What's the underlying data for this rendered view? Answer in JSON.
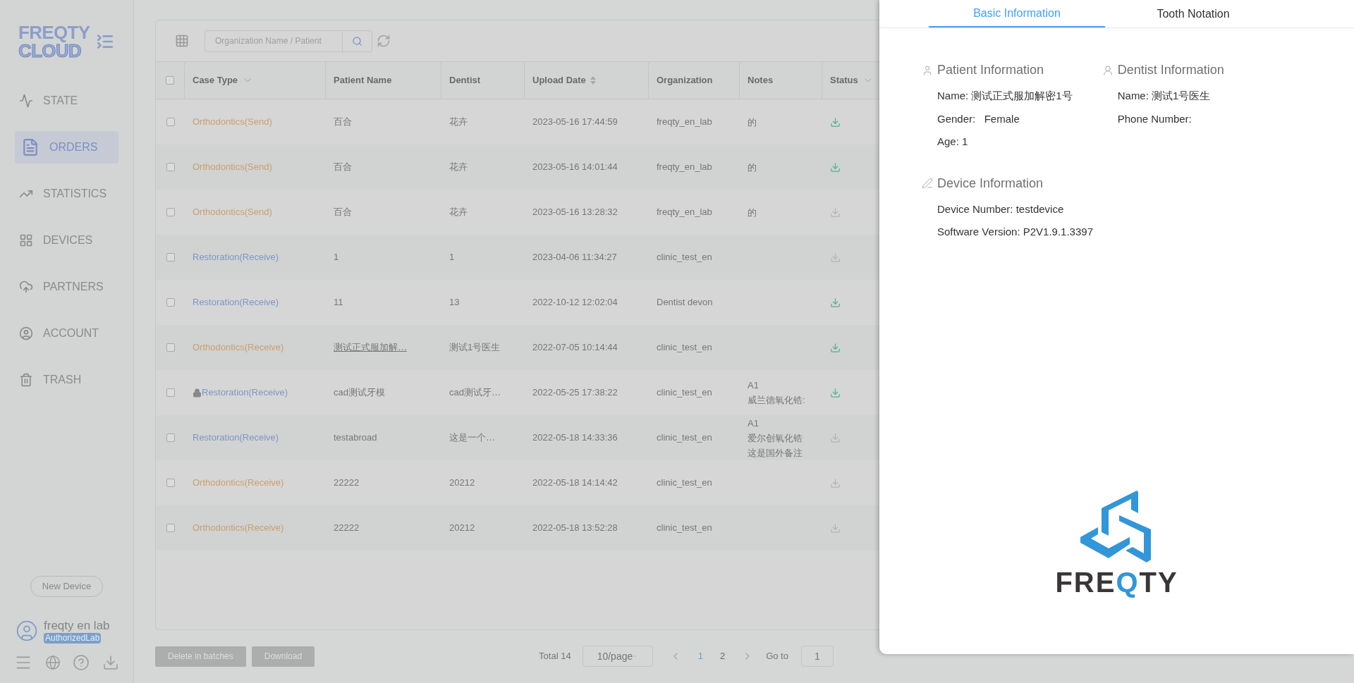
{
  "sidebar": {
    "logo": {
      "line1": "FREQTY",
      "line2": "CLOUD"
    },
    "items": [
      {
        "label": "STATE",
        "selected": false
      },
      {
        "label": "ORDERS",
        "selected": true
      },
      {
        "label": "STATISTICS",
        "selected": false
      },
      {
        "label": "DEVICES",
        "selected": false
      },
      {
        "label": "PARTNERS",
        "selected": false
      },
      {
        "label": "ACCOUNT",
        "selected": false
      },
      {
        "label": "TRASH",
        "selected": false
      }
    ],
    "new_device": "New Device",
    "user": {
      "name": "freqty en lab",
      "role": "AuthorizedLab"
    }
  },
  "toolbar": {
    "search": {
      "placeholder": "Organization Name / Patient"
    }
  },
  "table": {
    "all_checked": false,
    "columns": [
      {
        "label": "Case Type",
        "kind": "filter"
      },
      {
        "label": "Patient Name",
        "kind": "plain"
      },
      {
        "label": "Dentist",
        "kind": "plain"
      },
      {
        "label": "Upload Date",
        "kind": "sort"
      },
      {
        "label": "Organization",
        "kind": "plain"
      },
      {
        "label": "Notes",
        "kind": "plain"
      },
      {
        "label": "Status",
        "kind": "filter"
      }
    ],
    "rows": [
      {
        "checked": false,
        "case_type": "Orthodontics(Send)",
        "kind": "orthodontics",
        "locked": false,
        "patient": "百合",
        "patient_link": false,
        "dentist": "花卉",
        "date": "2023-05-16 17:44:59",
        "organization": "freqty_en_lab",
        "notes": [
          "的"
        ],
        "downloadable": true
      },
      {
        "checked": false,
        "case_type": "Orthodontics(Send)",
        "kind": "orthodontics",
        "locked": false,
        "patient": "百合",
        "patient_link": false,
        "dentist": "花卉",
        "date": "2023-05-16 14:01:44",
        "organization": "freqty_en_lab",
        "notes": [
          "的"
        ],
        "downloadable": true
      },
      {
        "checked": false,
        "case_type": "Orthodontics(Send)",
        "kind": "orthodontics",
        "locked": false,
        "patient": "百合",
        "patient_link": false,
        "dentist": "花卉",
        "date": "2023-05-16 13:28:32",
        "organization": "freqty_en_lab",
        "notes": [
          "的"
        ],
        "downloadable": false
      },
      {
        "checked": false,
        "case_type": "Restoration(Receive)",
        "kind": "restoration",
        "locked": false,
        "patient": "1",
        "patient_link": false,
        "dentist": "1",
        "date": "2023-04-06 11:34:27",
        "organization": "clinic_test_en",
        "notes": [],
        "downloadable": false
      },
      {
        "checked": false,
        "case_type": "Restoration(Receive)",
        "kind": "restoration",
        "locked": false,
        "patient": "11",
        "patient_link": false,
        "dentist": "13",
        "date": "2022-10-12 12:02:04",
        "organization": "Dentist devon",
        "notes": [],
        "downloadable": true
      },
      {
        "checked": false,
        "case_type": "Orthodontics(Receive)",
        "kind": "orthodontics",
        "locked": false,
        "patient": "测试正式服加解…",
        "patient_link": true,
        "dentist": "测试1号医生",
        "date": "2022-07-05 10:14:44",
        "organization": "clinic_test_en",
        "notes": [],
        "downloadable": true
      },
      {
        "checked": false,
        "case_type": "Restoration(Receive)",
        "kind": "restoration",
        "locked": true,
        "patient": "cad测试牙模",
        "patient_link": false,
        "dentist": "cad测试牙…",
        "date": "2022-05-25 17:38:22",
        "organization": "clinic_test_en",
        "notes": [
          "A1",
          "威兰德氧化锆:"
        ],
        "downloadable": true
      },
      {
        "checked": false,
        "case_type": "Restoration(Receive)",
        "kind": "restoration",
        "locked": false,
        "patient": "testabroad",
        "patient_link": false,
        "dentist": "这是一个…",
        "date": "2022-05-18 14:33:36",
        "organization": "clinic_test_en",
        "notes": [
          "A1",
          "爱尔创氧化锆",
          "这是国外备注"
        ],
        "downloadable": false
      },
      {
        "checked": false,
        "case_type": "Orthodontics(Receive)",
        "kind": "orthodontics",
        "locked": false,
        "patient": "22222",
        "patient_link": false,
        "dentist": "20212",
        "date": "2022-05-18 14:14:42",
        "organization": "clinic_test_en",
        "notes": [],
        "downloadable": false
      },
      {
        "checked": false,
        "case_type": "Orthodontics(Receive)",
        "kind": "orthodontics",
        "locked": false,
        "patient": "22222",
        "patient_link": false,
        "dentist": "20212",
        "date": "2022-05-18 13:52:28",
        "organization": "clinic_test_en",
        "notes": [],
        "downloadable": false
      }
    ]
  },
  "footer": {
    "buttons": [
      "Delete in batches",
      "Download"
    ],
    "total": "Total 14",
    "page_size": "10/page",
    "pages": [
      {
        "label": "1",
        "selected": true
      },
      {
        "label": "2",
        "selected": false
      }
    ],
    "goto_label": "Go to",
    "goto_value": "1"
  },
  "drawer": {
    "tabs": [
      {
        "label": "Basic Information",
        "selected": true
      },
      {
        "label": "Tooth Notation",
        "selected": false
      }
    ],
    "patient": {
      "title": "Patient Information",
      "lines": [
        "Name: 测试正式服加解密1号",
        "Gender:   Female",
        "Age: 1"
      ]
    },
    "dentist": {
      "title": "Dentist Information",
      "lines": [
        "Name: 测试1号医生",
        "Phone Number:"
      ]
    },
    "device": {
      "title": "Device Information",
      "lines": [
        "Device Number: testdevice",
        "Software Version: P2V1.9.1.3397"
      ]
    },
    "logo": {
      "prefix": "FRE",
      "highlight": "Q",
      "suffix": "TY"
    }
  }
}
